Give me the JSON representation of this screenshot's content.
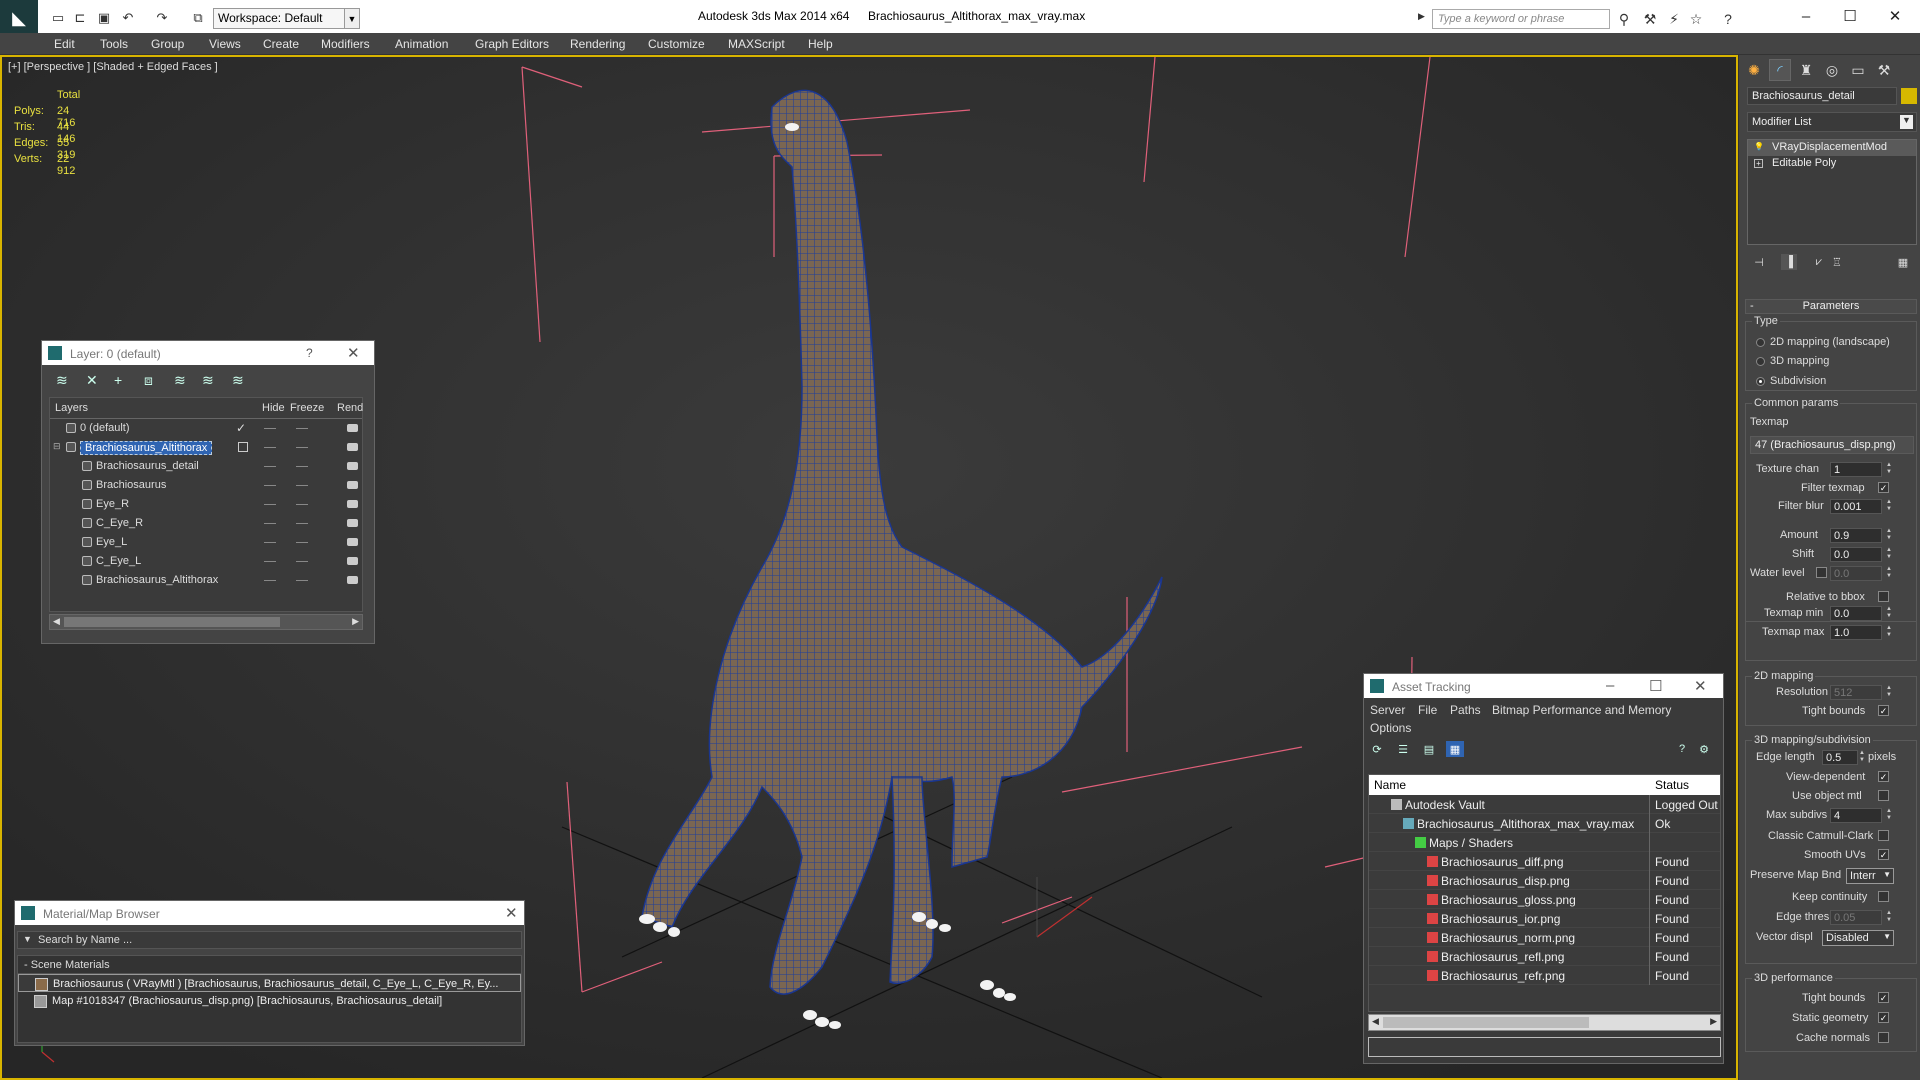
{
  "titlebar": {
    "workspace": "Workspace: Default",
    "app_title": "Autodesk 3ds Max  2014 x64",
    "file_name": "Brachiosaurus_Altithorax_max_vray.max",
    "search_placeholder": "Type a keyword or phrase",
    "minimize": "–",
    "maximize": "☐",
    "close": "✕"
  },
  "menu": [
    "Edit",
    "Tools",
    "Group",
    "Views",
    "Create",
    "Modifiers",
    "Animation",
    "Graph Editors",
    "Rendering",
    "Customize",
    "MAXScript",
    "Help"
  ],
  "viewport": {
    "label": "[+] [Perspective ] [Shaded + Edged Faces ]",
    "stats": {
      "header": "Total",
      "rows": [
        {
          "label": "Polys:",
          "value": "24 716"
        },
        {
          "label": "Tris:",
          "value": "44 146"
        },
        {
          "label": "Edges:",
          "value": "55 319"
        },
        {
          "label": "Verts:",
          "value": "22 912"
        }
      ]
    }
  },
  "layer_window": {
    "title": "Layer: 0 (default)",
    "help": "?",
    "close": "✕",
    "columns": {
      "layers": "Layers",
      "hide": "Hide",
      "freeze": "Freeze",
      "render": "Rend"
    },
    "rows": [
      {
        "name": "0 (default)",
        "indent": 1,
        "checked": true
      },
      {
        "name": "Brachiosaurus_Altithorax",
        "indent": 1,
        "selected": true
      },
      {
        "name": "Brachiosaurus_detail",
        "indent": 2
      },
      {
        "name": "Brachiosaurus",
        "indent": 2
      },
      {
        "name": "Eye_R",
        "indent": 2
      },
      {
        "name": "C_Eye_R",
        "indent": 2
      },
      {
        "name": "Eye_L",
        "indent": 2
      },
      {
        "name": "C_Eye_L",
        "indent": 2
      },
      {
        "name": "Brachiosaurus_Altithorax",
        "indent": 2
      }
    ]
  },
  "material_browser": {
    "title": "Material/Map Browser",
    "close": "✕",
    "search_placeholder": "Search by Name ...",
    "section": "- Scene Materials",
    "items": [
      {
        "text": "Brachiosaurus  ( VRayMtl ) [Brachiosaurus, Brachiosaurus_detail, C_Eye_L, C_Eye_R, Ey...",
        "swatch": "#8a6b4a"
      },
      {
        "text": "Map #1018347 (Brachiosaurus_disp.png) [Brachiosaurus, Brachiosaurus_detail]",
        "swatch": "#9a9a9a"
      }
    ]
  },
  "asset_tracking": {
    "title": "Asset Tracking",
    "minimize": "–",
    "maximize": "☐",
    "close": "✕",
    "menu": [
      "Server",
      "File",
      "Paths",
      "Bitmap Performance and Memory",
      "Options"
    ],
    "columns": {
      "name": "Name",
      "status": "Status"
    },
    "rows": [
      {
        "name": "Autodesk Vault",
        "status": "Logged Out",
        "indent": 1,
        "icon": "vault-icon"
      },
      {
        "name": "Brachiosaurus_Altithorax_max_vray.max",
        "status": "Ok",
        "indent": 2,
        "icon": "max-file-icon"
      },
      {
        "name": "Maps / Shaders",
        "status": "",
        "indent": 3,
        "icon": "maps-icon"
      },
      {
        "name": "Brachiosaurus_diff.png",
        "status": "Found",
        "indent": 4,
        "icon": "png-icon"
      },
      {
        "name": "Brachiosaurus_disp.png",
        "status": "Found",
        "indent": 4,
        "icon": "png-icon"
      },
      {
        "name": "Brachiosaurus_gloss.png",
        "status": "Found",
        "indent": 4,
        "icon": "png-icon"
      },
      {
        "name": "Brachiosaurus_ior.png",
        "status": "Found",
        "indent": 4,
        "icon": "png-icon"
      },
      {
        "name": "Brachiosaurus_norm.png",
        "status": "Found",
        "indent": 4,
        "icon": "png-icon"
      },
      {
        "name": "Brachiosaurus_refl.png",
        "status": "Found",
        "indent": 4,
        "icon": "png-icon"
      },
      {
        "name": "Brachiosaurus_refr.png",
        "status": "Found",
        "indent": 4,
        "icon": "png-icon"
      }
    ]
  },
  "command_panel": {
    "object_name": "Brachiosaurus_detail",
    "object_color": "#d6b800",
    "modifier_list": "Modifier List",
    "stack": [
      {
        "name": "VRayDisplacementMod",
        "selected": true
      },
      {
        "name": "Editable Poly",
        "selected": false
      }
    ],
    "parameters": {
      "header": "Parameters",
      "type_group": "Type",
      "type_options": [
        {
          "label": "2D mapping (landscape)",
          "selected": false
        },
        {
          "label": "3D mapping",
          "selected": false
        },
        {
          "label": "Subdivision",
          "selected": true
        }
      ],
      "common_group": "Common params",
      "texmap_label": "Texmap",
      "texmap_value": "47 (Brachiosaurus_disp.png)",
      "texture_chan_label": "Texture chan",
      "texture_chan": "1",
      "filter_texmap_label": "Filter texmap",
      "filter_texmap": true,
      "filter_blur_label": "Filter blur",
      "filter_blur": "0.001",
      "amount_label": "Amount",
      "amount": "0.9",
      "shift_label": "Shift",
      "shift": "0.0",
      "water_level_label": "Water level",
      "water_level": "0.0",
      "relative_bbox_label": "Relative to bbox",
      "texmap_min_label": "Texmap min",
      "texmap_min": "0.0",
      "texmap_max_label": "Texmap max",
      "texmap_max": "1.0",
      "mapping2d_group": "2D mapping",
      "resolution_label": "Resolution",
      "resolution": "512",
      "tight_bounds_label": "Tight bounds",
      "mapping3d_group": "3D mapping/subdivision",
      "edge_length_label": "Edge length",
      "edge_length": "0.5",
      "pixels_label": "pixels",
      "view_dependent_label": "View-dependent",
      "use_object_mtl_label": "Use object mtl",
      "max_subdivs_label": "Max subdivs",
      "max_subdivs": "4",
      "catmull_label": "Classic Catmull-Clark",
      "smooth_uvs_label": "Smooth UVs",
      "preserve_map_label": "Preserve Map Bnd",
      "preserve_map": "Interr",
      "keep_continuity_label": "Keep continuity",
      "edge_thresh_label": "Edge thresh",
      "edge_thresh": "0.05",
      "vector_displ_label": "Vector displ",
      "vector_displ": "Disabled",
      "perf_group": "3D performance",
      "perf_tight_bounds_label": "Tight bounds",
      "static_geometry_label": "Static geometry",
      "cache_normals_label": "Cache normals"
    }
  }
}
